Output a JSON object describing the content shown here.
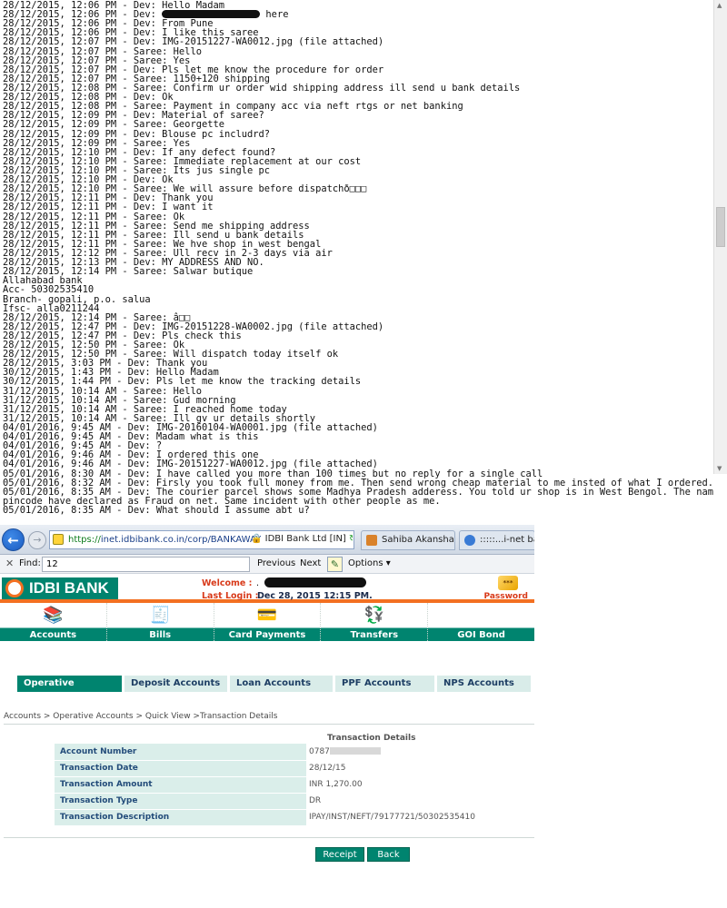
{
  "chat": {
    "messages": [
      "28/12/2015, 12:06 PM - Dev: Hello Madam",
      "28/12/2015, 12:06 PM - Dev: [REDACT] here",
      "28/12/2015, 12:06 PM - Dev: From Pune",
      "28/12/2015, 12:06 PM - Dev: I like this saree",
      "28/12/2015, 12:07 PM - Dev: IMG-20151227-WA0012.jpg (file attached)",
      "28/12/2015, 12:07 PM - Saree: Hello",
      "28/12/2015, 12:07 PM - Saree: Yes",
      "28/12/2015, 12:07 PM - Dev: Pls let me know the procedure for order",
      "28/12/2015, 12:07 PM - Saree: 1150+120 shipping",
      "28/12/2015, 12:08 PM - Saree: Confirm ur order wid shipping address ill send u bank details",
      "28/12/2015, 12:08 PM - Dev: Ok",
      "28/12/2015, 12:08 PM - Saree: Payment in company acc via neft rtgs or net banking",
      "28/12/2015, 12:09 PM - Dev: Material of saree?",
      "28/12/2015, 12:09 PM - Saree: Georgette",
      "28/12/2015, 12:09 PM - Dev: Blouse pc includrd?",
      "28/12/2015, 12:09 PM - Saree: Yes",
      "28/12/2015, 12:10 PM - Dev: If any defect found?",
      "28/12/2015, 12:10 PM - Saree: Immediate replacement at our cost",
      "28/12/2015, 12:10 PM - Saree: Its jus single pc",
      "28/12/2015, 12:10 PM - Dev: Ok",
      "28/12/2015, 12:10 PM - Saree: We will assure before dispatchð□□□",
      "28/12/2015, 12:11 PM - Dev: Thank you",
      "28/12/2015, 12:11 PM - Dev: I want it",
      "28/12/2015, 12:11 PM - Saree: Ok",
      "28/12/2015, 12:11 PM - Saree: Send me shipping address",
      "28/12/2015, 12:11 PM - Saree: Ill send u bank details",
      "28/12/2015, 12:11 PM - Saree: We hve shop in west bengal",
      "28/12/2015, 12:12 PM - Saree: Ull recv in 2-3 days via air",
      "28/12/2015, 12:13 PM - Dev: MY ADDRESS AND NO.",
      "28/12/2015, 12:14 PM - Saree: Salwar butique",
      "Allahabad bank",
      "Acc- 50302535410",
      "Branch- gopali, p.o. salua",
      "Ifsc- alla0211244",
      "28/12/2015, 12:14 PM - Saree: â□□",
      "28/12/2015, 12:47 PM - Dev: IMG-20151228-WA0002.jpg (file attached)",
      "28/12/2015, 12:47 PM - Dev: Pls check this",
      "28/12/2015, 12:50 PM - Saree: Ok",
      "28/12/2015, 12:50 PM - Saree: Will dispatch today itself ok",
      "28/12/2015, 3:03 PM - Dev: Thank you",
      "30/12/2015, 1:43 PM - Dev: Hello Madam",
      "30/12/2015, 1:44 PM - Dev: Pls let me know the tracking details",
      "31/12/2015, 10:14 AM - Saree: Hello",
      "31/12/2015, 10:14 AM - Saree: Gud morning",
      "31/12/2015, 10:14 AM - Saree: I reached home today",
      "31/12/2015, 10:14 AM - Saree: Ill gv ur details shortly",
      "04/01/2016, 9:45 AM - Dev: IMG-20160104-WA0001.jpg (file attached)",
      "04/01/2016, 9:45 AM - Dev: Madam what is this",
      "04/01/2016, 9:45 AM - Dev: ?",
      "04/01/2016, 9:46 AM - Dev: I ordered this one",
      "04/01/2016, 9:46 AM - Dev: IMG-20151227-WA0012.jpg (file attached)",
      "05/01/2016, 8:30 AM - Dev: I have called you more than 100 times but no reply for a single call",
      "05/01/2016, 8:32 AM - Dev: Firsly you took full money from me. Then send wrong cheap material to me insted of what I ordered.",
      "05/01/2016, 8:35 AM - Dev: The courier parcel shows some Madhya Pradesh adderess. You told ur shop is in West Bengol. The nam",
      "pincode have declared as Fraud on net. Same incident with other people as me.",
      "05/01/2016, 8:35 AM - Dev: What should I assume abt u?"
    ]
  },
  "browser": {
    "url_secure": "https://",
    "url_rest": "inet.idbibank.co.in/corp/BANKAWAY",
    "cert_label": "IDBI Bank Ltd [IN]",
    "tabs": [
      "Sahiba Akansha V...",
      ":::::...i-net bank..."
    ],
    "find": {
      "close": "✕",
      "label": "Find:",
      "value": "12",
      "prev": "Previous",
      "next": "Next",
      "options": "Options ▾"
    }
  },
  "bank": {
    "logo": "IDBI BANK",
    "welcome_label": "Welcome :",
    "welcome_value": ".",
    "last_login_label": "Last Login :",
    "last_login_value": "Dec 28, 2015 12:15 PM.",
    "password_label": "Password",
    "menu": [
      {
        "label": "Accounts",
        "icon": "books-icon",
        "glyph": "📚"
      },
      {
        "label": "Bills",
        "icon": "stamp-icon",
        "glyph": "🧾"
      },
      {
        "label": "Card Payments",
        "icon": "credit-card-icon",
        "glyph": "💳"
      },
      {
        "label": "Transfers",
        "icon": "money-transfer-icon",
        "glyph": "💱"
      },
      {
        "label": "GOI Bond",
        "icon": "emblem-icon",
        "glyph": "🏛"
      }
    ],
    "account_tabs": [
      "Operative Accounts",
      "Deposit Accounts",
      "Loan Accounts",
      "PPF Accounts",
      "NPS Accounts"
    ],
    "breadcrumb": "Accounts > Operative Accounts > Quick View >Transaction Details",
    "txn_title": "Transaction Details",
    "txn_rows": [
      {
        "label": "Account Number",
        "value": "0787"
      },
      {
        "label": "Transaction Date",
        "value": " 28/12/15"
      },
      {
        "label": "Transaction Amount",
        "value": "INR 1,270.00"
      },
      {
        "label": "Transaction Type",
        "value": "DR"
      },
      {
        "label": " Transaction Description",
        "value": "IPAY/INST/NEFT/79177721/50302535410"
      }
    ],
    "buttons": {
      "receipt": "Receipt",
      "back": "Back"
    }
  },
  "colors": {
    "bank_green": "#00846f",
    "bank_orange": "#f37021",
    "label_red": "#d83a1a"
  }
}
